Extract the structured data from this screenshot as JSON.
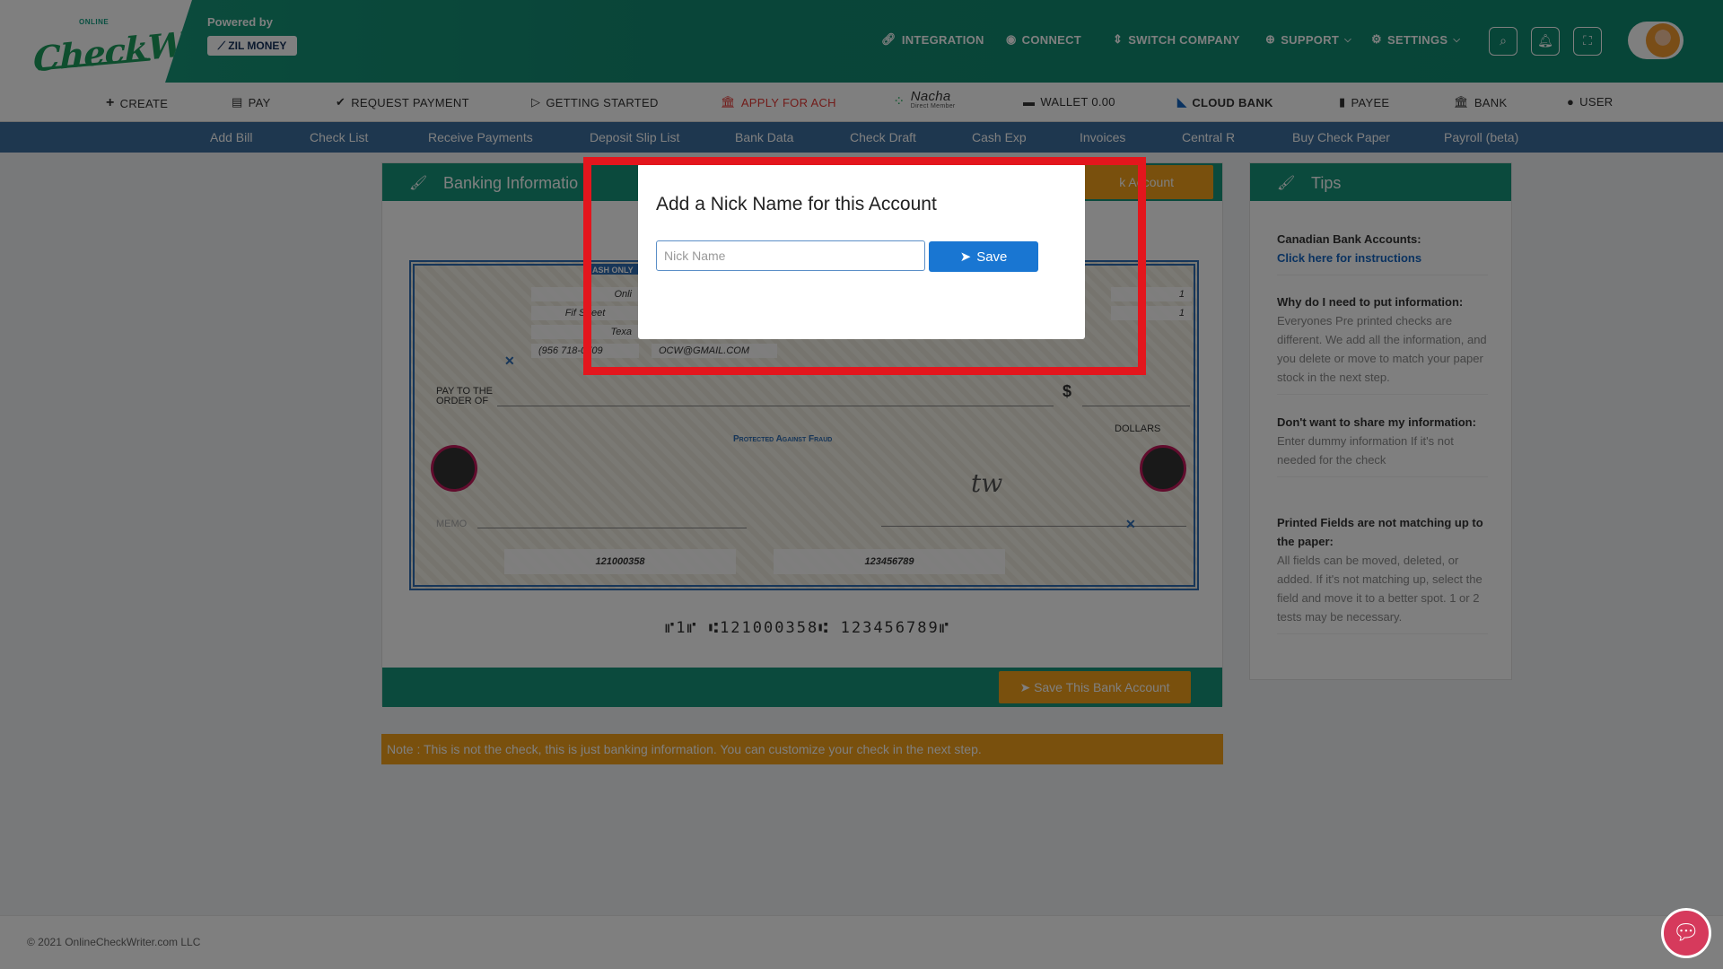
{
  "header": {
    "brand_small": "ONLINE",
    "brand_main": "CheckWRITER",
    "powered_by": "Powered by",
    "partner": "ZIL MONEY",
    "nav": [
      {
        "label": "INTEGRATION",
        "icon": "link-icon"
      },
      {
        "label": "CONNECT",
        "icon": "globe-icon"
      },
      {
        "label": "SWITCH COMPANY",
        "icon": "switch-icon"
      },
      {
        "label": "SUPPORT",
        "icon": "support-icon"
      },
      {
        "label": "SETTINGS",
        "icon": "gear-icon"
      }
    ]
  },
  "nav2": [
    {
      "label": "CREATE",
      "icon": "plus-icon"
    },
    {
      "label": "PAY",
      "icon": "pay-icon"
    },
    {
      "label": "REQUEST PAYMENT",
      "icon": "check-circle-icon"
    },
    {
      "label": "GETTING STARTED",
      "icon": "play-icon"
    },
    {
      "label": "APPLY FOR ACH",
      "icon": "bank-icon"
    },
    {
      "label": "Nacha",
      "sub": "Direct Member"
    },
    {
      "label": "WALLET 0.00",
      "icon": "wallet-icon"
    },
    {
      "label": "CLOUD BANK",
      "icon": "cloud-bank-icon"
    },
    {
      "label": "PAYEE",
      "icon": "payee-icon"
    },
    {
      "label": "BANK",
      "icon": "bank-icon"
    },
    {
      "label": "USER",
      "icon": "user-icon"
    }
  ],
  "nav3": [
    "Add Bill",
    "Check List",
    "Receive Payments",
    "Deposit Slip List",
    "Bank Data",
    "Check Draft",
    "Cash Exp",
    "Invoices",
    "Central R",
    "Buy Check Paper",
    "Payroll (beta)"
  ],
  "banking": {
    "title": "Banking Informatio",
    "header_button": "k Account",
    "check": {
      "cash_only": "ASH ONLY",
      "line1": "Onli",
      "line2": "Fif   Street",
      "line3": "Texa",
      "phone": "(956  718-0709",
      "email": "OCW@GMAIL.COM",
      "right1": "1",
      "right2": "1",
      "pay_to": "PAY TO THE",
      "order_of": "ORDER OF",
      "dollar_sign": "$",
      "dollars": "DOLLARS",
      "protected": "Protected Against Fraud",
      "memo": "MEMO",
      "routing": "121000358",
      "account": "123456789",
      "signature": "tw"
    },
    "micr": "⑈1⑈ ⑆121000358⑆ 123456789⑈",
    "save_button": "Save This Bank Account",
    "note": "Note : This is not the check, this is just banking information. You can customize your check in the next step."
  },
  "tips": {
    "title": "Tips",
    "items": [
      {
        "heading": "Canadian Bank Accounts:",
        "text": "Click here for instructions"
      },
      {
        "heading": "Why do I need to put information:",
        "text": "Everyones Pre printed checks are different. We add all the information, and you delete or move to match your paper stock in the next step."
      },
      {
        "heading": "Don't want to share my information:",
        "text": "Enter dummy information If it's not needed for the check"
      },
      {
        "heading": "Printed Fields are not matching up to the paper:",
        "text": "All fields can be moved, deleted, or added. If it's not matching up, select the field and move it to a better spot. 1 or 2 tests may be necessary."
      }
    ]
  },
  "footer": {
    "copyright": "© 2021 OnlineCheckWriter.com LLC"
  },
  "modal": {
    "title": "Add a Nick Name for this Account",
    "placeholder": "Nick Name",
    "value": "",
    "save_label": "Save"
  },
  "colors": {
    "primary": "#16957a",
    "accent": "#f2a11b",
    "highlight": "#e3161d",
    "save": "#1976d2"
  }
}
